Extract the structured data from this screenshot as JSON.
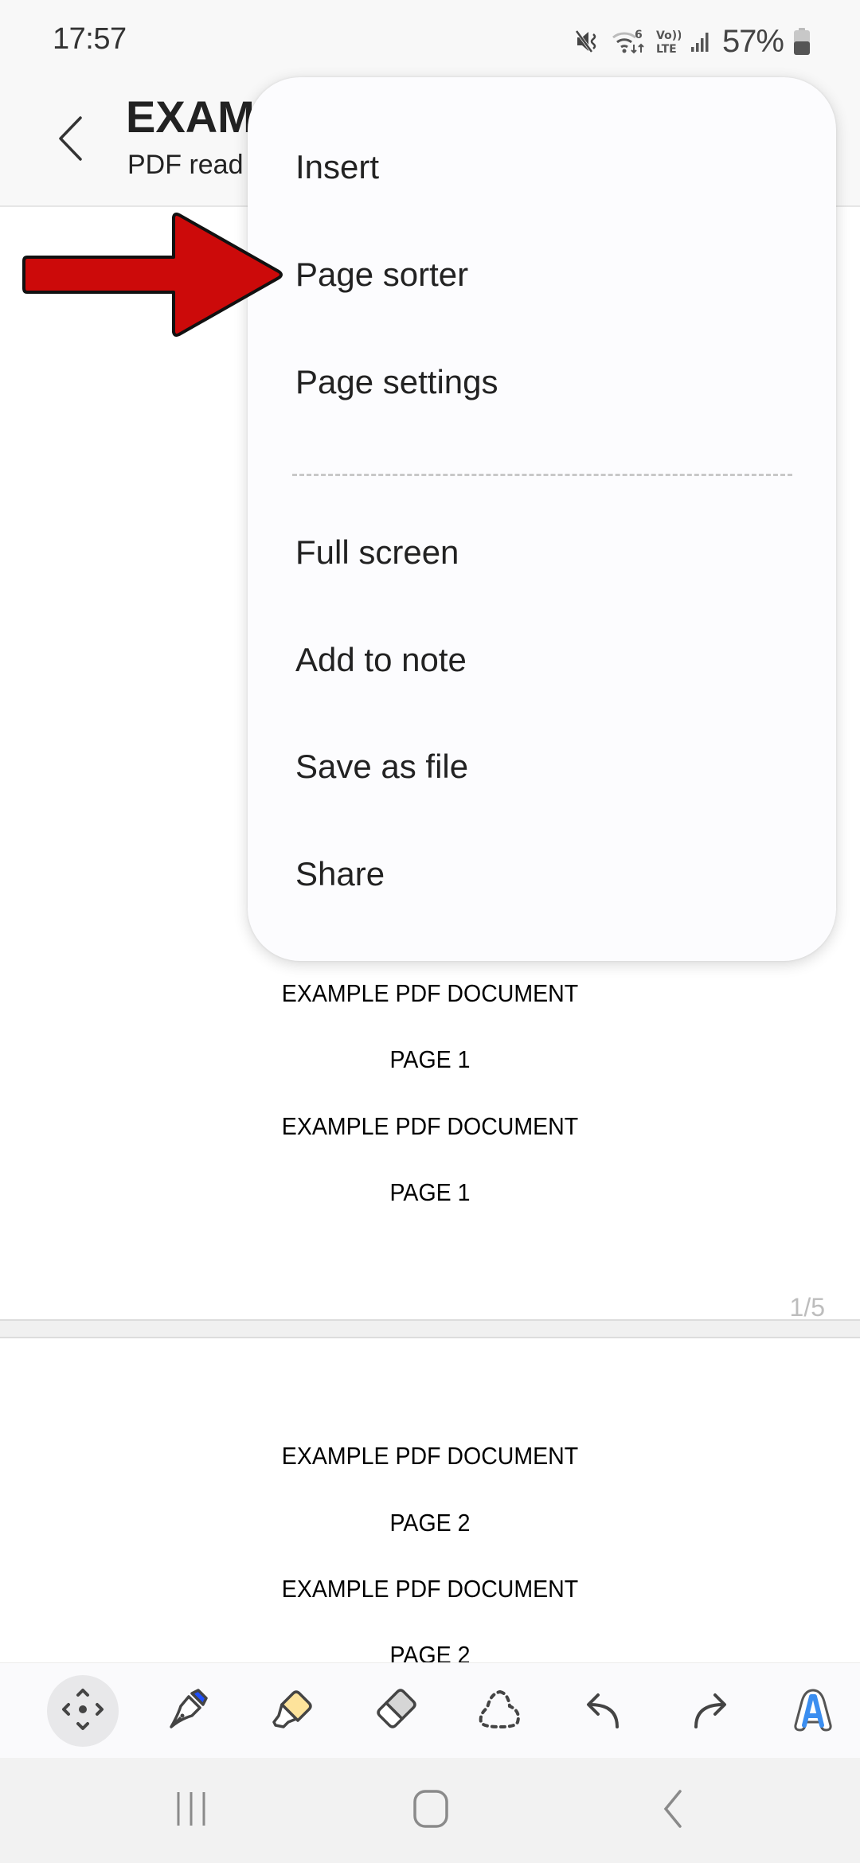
{
  "status_bar": {
    "time": "17:57",
    "battery_percent": "57%",
    "icons": [
      "mute-icon",
      "wifi-6-icon",
      "volte-icon",
      "signal-icon",
      "battery-icon"
    ]
  },
  "header": {
    "title_visible": "EXAM",
    "subtitle_visible": "PDF read",
    "back_icon": "chevron-left-icon"
  },
  "menu": {
    "items": [
      {
        "label": "Insert"
      },
      {
        "label": "Page sorter"
      },
      {
        "label": "Page settings"
      },
      {
        "label": "Full screen"
      },
      {
        "label": "Add to note"
      },
      {
        "label": "Save as file"
      },
      {
        "label": "Share"
      }
    ],
    "highlighted_item": "Page sorter"
  },
  "annotation": {
    "arrow_color": "#cc0a0a",
    "points_to": "Page sorter"
  },
  "document": {
    "pages": [
      {
        "lines": [
          "EXAMPLE PDF DOCUMENT",
          "PAGE 1",
          "EXAMPLE PDF DOCUMENT",
          "PAGE 1"
        ]
      },
      {
        "lines": [
          "EXAMPLE PDF DOCUMENT",
          "PAGE 2",
          "EXAMPLE PDF DOCUMENT",
          "PAGE 2"
        ]
      }
    ],
    "page_indicator": "1/5"
  },
  "toolbar": {
    "tools": [
      {
        "name": "pan",
        "icon": "move-arrows-icon",
        "active": true
      },
      {
        "name": "pen",
        "icon": "fountain-pen-icon",
        "color": "#1f4fff"
      },
      {
        "name": "highlighter",
        "icon": "highlighter-icon",
        "color": "#fde39b"
      },
      {
        "name": "eraser",
        "icon": "eraser-icon",
        "color": "#d6d6d6"
      },
      {
        "name": "lasso",
        "icon": "lasso-icon"
      },
      {
        "name": "undo",
        "icon": "undo-icon"
      },
      {
        "name": "redo",
        "icon": "redo-icon"
      },
      {
        "name": "text",
        "icon": "text-a-icon",
        "color": "#3b8ef0"
      }
    ]
  },
  "nav_bar": {
    "buttons": [
      "recents",
      "home",
      "back"
    ]
  }
}
